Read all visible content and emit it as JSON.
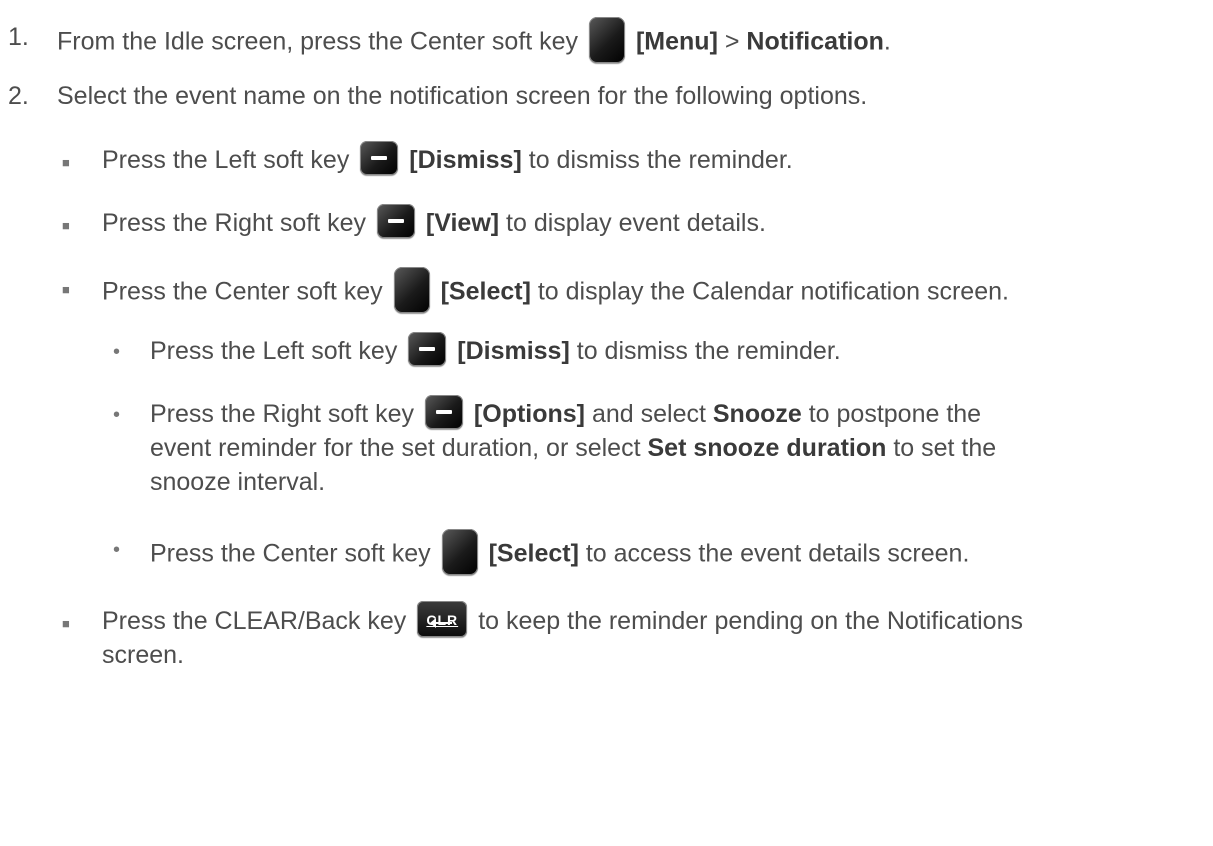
{
  "step1": {
    "number": "1.",
    "text_a": "From the Idle screen, press the Center soft key",
    "key_label": "[Menu]",
    "text_b": " > ",
    "menu_item": "Notification",
    "end": "."
  },
  "step2": {
    "number": "2.",
    "text": "Select the event name on the notification screen for the following options."
  },
  "bullets": [
    {
      "text_a": "Press the Left soft key",
      "key_label": "[Dismiss]",
      "text_b": " to dismiss the reminder."
    },
    {
      "text_a": "Press the Right soft key",
      "key_label": "[View]",
      "text_b": " to display event details."
    },
    {
      "text_a": "Press the Center soft key",
      "key_label": "[Select]",
      "text_b": " to display the Calendar notification screen."
    }
  ],
  "sub_bullets": [
    {
      "text_a": "Press the Left soft key",
      "key_label": "[Dismiss]",
      "text_b": " to dismiss the reminder."
    },
    {
      "text_a": "Press the Right soft key",
      "key_label": "[Options]",
      "text_b": " and select ",
      "bold1": "Snooze",
      "text_c": " to postpone the",
      "line2_a": "event reminder for the set duration, or select ",
      "bold2": "Set snooze duration",
      "line2_b": " to set the",
      "line3": "snooze interval."
    },
    {
      "text_a": "Press the Center soft key",
      "key_label": "[Select]",
      "text_b": " to access the event details screen."
    }
  ],
  "last_bullet": {
    "text_a": "Press the CLEAR/Back key",
    "key_label": "CLR",
    "text_b": " to keep the reminder pending on the Notifications",
    "line2": "screen."
  },
  "markers": {
    "square": "■",
    "dot": "•"
  },
  "icons": {
    "center_key": "center-soft-key-icon",
    "soft_key": "soft-key-icon",
    "clear_key": "clear-back-key-icon"
  }
}
